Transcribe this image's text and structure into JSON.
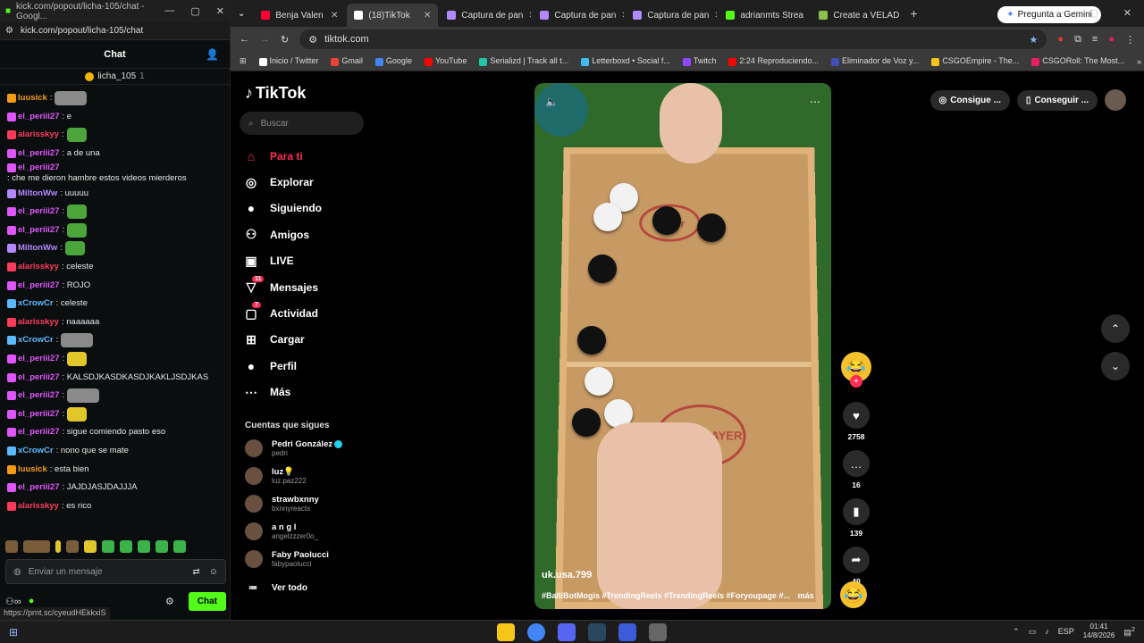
{
  "kick": {
    "window_title": "kick.com/popout/licha-105/chat - Googl...",
    "url": "kick.com/popout/licha-105/chat",
    "header": "Chat",
    "pinned_user": "licha_105",
    "pinned_count": "1",
    "messages": [
      {
        "user": "luusick",
        "color": "#f39c12",
        "text": ":",
        "emote": "wide"
      },
      {
        "user": "el_periii27",
        "color": "#e056fd",
        "text": ": e"
      },
      {
        "user": "alarisskyy",
        "color": "#ff3b5c",
        "text": ":",
        "emote": "green"
      },
      {
        "user": "el_periii27",
        "color": "#e056fd",
        "text": ": a de una"
      },
      {
        "user": "el_periii27",
        "color": "#e056fd",
        "text": ": che me dieron hambre estos videos mierderos"
      },
      {
        "user": "MiltonWw",
        "color": "#b388ff",
        "text": ": uuuuu"
      },
      {
        "user": "el_periii27",
        "color": "#e056fd",
        "text": ":",
        "emote": "green"
      },
      {
        "user": "el_periii27",
        "color": "#e056fd",
        "text": ":",
        "emote": "green"
      },
      {
        "user": "MiltonWw",
        "color": "#b388ff",
        "text": ":",
        "emote": "green"
      },
      {
        "user": "alarisskyy",
        "color": "#ff3b5c",
        "text": ": celeste"
      },
      {
        "user": "el_periii27",
        "color": "#e056fd",
        "text": ": ROJO"
      },
      {
        "user": "xCrowCr",
        "color": "#5ab9ff",
        "text": ": celeste"
      },
      {
        "user": "alarisskyy",
        "color": "#ff3b5c",
        "text": ": naaaaaa"
      },
      {
        "user": "xCrowCr",
        "color": "#5ab9ff",
        "text": ":",
        "emote": "wide"
      },
      {
        "user": "el_periii27",
        "color": "#e056fd",
        "text": ":",
        "emote": "yellow"
      },
      {
        "user": "el_periii27",
        "color": "#e056fd",
        "text": ": KALSDJKASDKASDJKAKLJSDJKAS"
      },
      {
        "user": "el_periii27",
        "color": "#e056fd",
        "text": ":",
        "emote": "wide"
      },
      {
        "user": "el_periii27",
        "color": "#e056fd",
        "text": ":",
        "emote": "yellow"
      },
      {
        "user": "el_periii27",
        "color": "#e056fd",
        "text": ": sigue comiendo pasto eso"
      },
      {
        "user": "xCrowCr",
        "color": "#5ab9ff",
        "text": ": nono que se mate"
      },
      {
        "user": "luusick",
        "color": "#f39c12",
        "text": ": esta bien"
      },
      {
        "user": "el_periii27",
        "color": "#e056fd",
        "text": ": JAJDJASJDAJJJA"
      },
      {
        "user": "alarisskyy",
        "color": "#ff3b5c",
        "text": ": es rico"
      }
    ],
    "input_placeholder": "Enviar un mensaje",
    "chat_button": "Chat",
    "status_url": "https://prnt.sc/cyeudHEkkxiS"
  },
  "chrome": {
    "tabs": [
      {
        "label": "Benja Valen",
        "color": "#ff0033",
        "active": false
      },
      {
        "label": "(18)TikTok",
        "color": "#ffffff",
        "active": true
      },
      {
        "label": "Captura de pan",
        "color": "#b388ff",
        "active": false
      },
      {
        "label": "Captura de pan",
        "color": "#b388ff",
        "active": false
      },
      {
        "label": "Captura de pan",
        "color": "#b388ff",
        "active": false
      },
      {
        "label": "adrianmts Strea",
        "color": "#53fc18",
        "active": false
      },
      {
        "label": "Create a VELAD",
        "color": "#8bc34a",
        "active": false
      }
    ],
    "gemini": "Pregunta a Gemini",
    "url": "tiktok.com",
    "bookmarks": [
      {
        "label": "Inicio / Twitter",
        "color": "#ffffff"
      },
      {
        "label": "Gmail",
        "color": "#ea4335"
      },
      {
        "label": "Google",
        "color": "#4285f4"
      },
      {
        "label": "YouTube",
        "color": "#ff0000"
      },
      {
        "label": "Serializd | Track all t...",
        "color": "#21c7a8"
      },
      {
        "label": "Letterboxd • Social f...",
        "color": "#40bcf4"
      },
      {
        "label": "Twitch",
        "color": "#9146ff"
      },
      {
        "label": "2:24 Reproduciendo...",
        "color": "#ff0000"
      },
      {
        "label": "Eliminador de Voz y...",
        "color": "#3f51b5"
      },
      {
        "label": "CSGOEmpire - The...",
        "color": "#f5c518"
      },
      {
        "label": "CSGORoll: The Most...",
        "color": "#e91e63"
      }
    ]
  },
  "tiktok": {
    "brand": "TikTok",
    "search_placeholder": "Buscar",
    "nav": [
      {
        "label": "Para ti",
        "icon": "home-icon",
        "glyph": "⌂",
        "active": true,
        "badge": ""
      },
      {
        "label": "Explorar",
        "icon": "compass-icon",
        "glyph": "◎",
        "active": false,
        "badge": ""
      },
      {
        "label": "Siguiendo",
        "icon": "following-avatar-icon",
        "glyph": "●",
        "active": false,
        "badge": ""
      },
      {
        "label": "Amigos",
        "icon": "friends-icon",
        "glyph": "⚇",
        "active": false,
        "badge": ""
      },
      {
        "label": "LIVE",
        "icon": "live-icon",
        "glyph": "▣",
        "active": false,
        "badge": ""
      },
      {
        "label": "Mensajes",
        "icon": "messages-icon",
        "glyph": "▽",
        "active": false,
        "badge": "11"
      },
      {
        "label": "Actividad",
        "icon": "activity-icon",
        "glyph": "▢",
        "active": false,
        "badge": "7"
      },
      {
        "label": "Cargar",
        "icon": "upload-icon",
        "glyph": "⊞",
        "active": false,
        "badge": ""
      },
      {
        "label": "Perfil",
        "icon": "profile-avatar-icon",
        "glyph": "●",
        "active": false,
        "badge": ""
      },
      {
        "label": "Más",
        "icon": "more-icon",
        "glyph": "⋯",
        "active": false,
        "badge": ""
      }
    ],
    "follows_title": "Cuentas que sigues",
    "follows": [
      {
        "name": "Pedri González",
        "handle": "pedri",
        "verified": true
      },
      {
        "name": "luz💡",
        "handle": "luz.paz222",
        "verified": false
      },
      {
        "name": "strawbxnny",
        "handle": "bxnnyreacts",
        "verified": false
      },
      {
        "name": "a n g l",
        "handle": "angelzzzer0o_",
        "verified": false
      },
      {
        "name": "Faby Paolucci",
        "handle": "fabypaolucci",
        "verified": false
      }
    ],
    "view_all": "Ver todo",
    "coins_label": "Consigue ...",
    "app_label": "Conseguir ...",
    "video": {
      "author": "uk.usa.799",
      "tags": "#BalliBotMogis #TrendingReels #TrendingReels #Foryoupage #...",
      "more": "más",
      "board_text_top": "Super",
      "board_text_bottom": "Super PLAYER"
    },
    "actions": {
      "likes": "2758",
      "comments": "16",
      "saves": "139",
      "shares": "49"
    }
  },
  "taskbar": {
    "lang": "ESP",
    "time": "01:41",
    "date": "14/8/2026",
    "notif": "2"
  }
}
